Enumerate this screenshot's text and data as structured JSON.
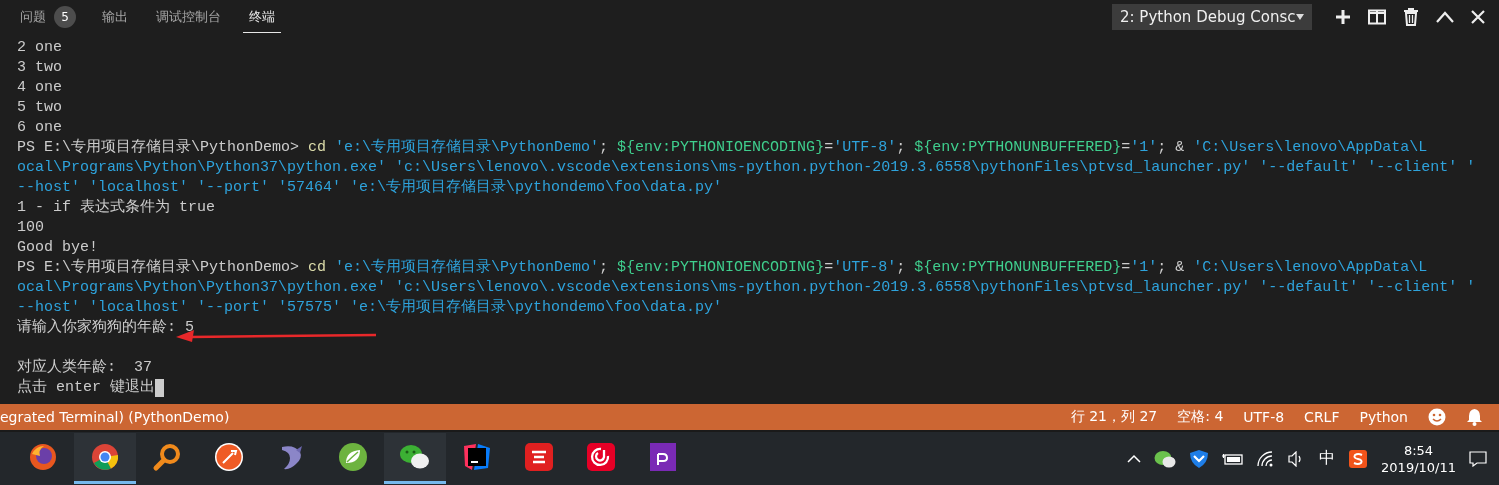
{
  "panel_tabs": [
    {
      "label": "问题",
      "badge": "5",
      "selected": false
    },
    {
      "label": "输出",
      "selected": false
    },
    {
      "label": "调试控制台",
      "selected": false
    },
    {
      "label": "终端",
      "selected": true
    }
  ],
  "terminal_select": {
    "value": "2: Python Debug Consc"
  },
  "terminal_lines": [
    {
      "segments": [
        {
          "kind": "plain",
          "text": "2 one"
        }
      ],
      "blank_before": false,
      "cursor": false
    },
    {
      "segments": [
        {
          "kind": "plain",
          "text": "3 two"
        }
      ],
      "blank_before": false,
      "cursor": false
    },
    {
      "segments": [
        {
          "kind": "plain",
          "text": "4 one"
        }
      ],
      "blank_before": false,
      "cursor": false
    },
    {
      "segments": [
        {
          "kind": "plain",
          "text": "5 two"
        }
      ],
      "blank_before": false,
      "cursor": false
    },
    {
      "segments": [
        {
          "kind": "plain",
          "text": "6 one"
        }
      ],
      "blank_before": false,
      "cursor": false
    },
    {
      "segments": [
        {
          "kind": "plain",
          "text": "PS E:\\专用项目存储目录\\PythonDemo> "
        },
        {
          "kind": "command",
          "text": "cd "
        },
        {
          "kind": "string",
          "text": "'e:\\专用项目存储目录\\PythonDemo'"
        },
        {
          "kind": "plain",
          "text": "; "
        },
        {
          "kind": "variable",
          "text": "${env:PYTHONIOENCODING}"
        },
        {
          "kind": "plain",
          "text": "="
        },
        {
          "kind": "string",
          "text": "'UTF-8'"
        },
        {
          "kind": "plain",
          "text": "; "
        },
        {
          "kind": "variable",
          "text": "${env:PYTHONUNBUFFERED}"
        },
        {
          "kind": "plain",
          "text": "="
        },
        {
          "kind": "string",
          "text": "'1'"
        },
        {
          "kind": "plain",
          "text": "; & "
        },
        {
          "kind": "string",
          "text": "'C:\\Users\\lenovo\\AppData\\L"
        }
      ],
      "blank_before": false,
      "cursor": false
    },
    {
      "segments": [
        {
          "kind": "string",
          "text": "ocal\\Programs\\Python\\Python37\\python.exe' 'c:\\Users\\lenovo\\.vscode\\extensions\\ms-python.python-2019.3.6558\\pythonFiles\\ptvsd_launcher.py' '--default' '--client' '"
        }
      ],
      "blank_before": false,
      "cursor": false
    },
    {
      "segments": [
        {
          "kind": "string",
          "text": "--host' 'localhost' '--port' '57464' 'e:\\专用项目存储目录\\pythondemo\\foo\\data.py'"
        }
      ],
      "blank_before": false,
      "cursor": false
    },
    {
      "segments": [
        {
          "kind": "plain",
          "text": "1 - if 表达式条件为 true"
        }
      ],
      "blank_before": false,
      "cursor": false
    },
    {
      "segments": [
        {
          "kind": "plain",
          "text": "100"
        }
      ],
      "blank_before": false,
      "cursor": false
    },
    {
      "segments": [
        {
          "kind": "plain",
          "text": "Good bye!"
        }
      ],
      "blank_before": false,
      "cursor": false
    },
    {
      "segments": [
        {
          "kind": "plain",
          "text": "PS E:\\专用项目存储目录\\PythonDemo> "
        },
        {
          "kind": "command",
          "text": "cd "
        },
        {
          "kind": "string",
          "text": "'e:\\专用项目存储目录\\PythonDemo'"
        },
        {
          "kind": "plain",
          "text": "; "
        },
        {
          "kind": "variable",
          "text": "${env:PYTHONIOENCODING}"
        },
        {
          "kind": "plain",
          "text": "="
        },
        {
          "kind": "string",
          "text": "'UTF-8'"
        },
        {
          "kind": "plain",
          "text": "; "
        },
        {
          "kind": "variable",
          "text": "${env:PYTHONUNBUFFERED}"
        },
        {
          "kind": "plain",
          "text": "="
        },
        {
          "kind": "string",
          "text": "'1'"
        },
        {
          "kind": "plain",
          "text": "; & "
        },
        {
          "kind": "string",
          "text": "'C:\\Users\\lenovo\\AppData\\L"
        }
      ],
      "blank_before": false,
      "cursor": false
    },
    {
      "segments": [
        {
          "kind": "string",
          "text": "ocal\\Programs\\Python\\Python37\\python.exe' 'c:\\Users\\lenovo\\.vscode\\extensions\\ms-python.python-2019.3.6558\\pythonFiles\\ptvsd_launcher.py' '--default' '--client' '"
        }
      ],
      "blank_before": false,
      "cursor": false
    },
    {
      "segments": [
        {
          "kind": "string",
          "text": "--host' 'localhost' '--port' '57575' 'e:\\专用项目存储目录\\pythondemo\\foo\\data.py'"
        }
      ],
      "blank_before": false,
      "cursor": false
    },
    {
      "segments": [
        {
          "kind": "plain",
          "text": "请输入你家狗狗的年龄: 5"
        }
      ],
      "blank_before": false,
      "cursor": false
    },
    {
      "segments": [
        {
          "kind": "plain",
          "text": "对应人类年龄:  37"
        }
      ],
      "blank_before": true,
      "cursor": false
    },
    {
      "segments": [
        {
          "kind": "plain",
          "text": "点击 enter 键退出"
        }
      ],
      "blank_before": false,
      "cursor": true
    }
  ],
  "status_bar": {
    "left": "egrated Terminal) (PythonDemo)",
    "items": [
      "行 21，列 27",
      "空格: 4",
      "UTF-8",
      "CRLF",
      "Python"
    ]
  },
  "taskbar": {
    "apps": [
      {
        "active": false
      },
      {
        "active": true
      },
      {
        "active": false
      },
      {
        "active": false
      },
      {
        "active": false
      },
      {
        "active": false
      },
      {
        "active": true
      },
      {
        "active": false
      },
      {
        "active": false
      },
      {
        "active": false
      },
      {
        "active": false
      }
    ],
    "input_method": "中",
    "time": "8:54",
    "date": "2019/10/11"
  }
}
